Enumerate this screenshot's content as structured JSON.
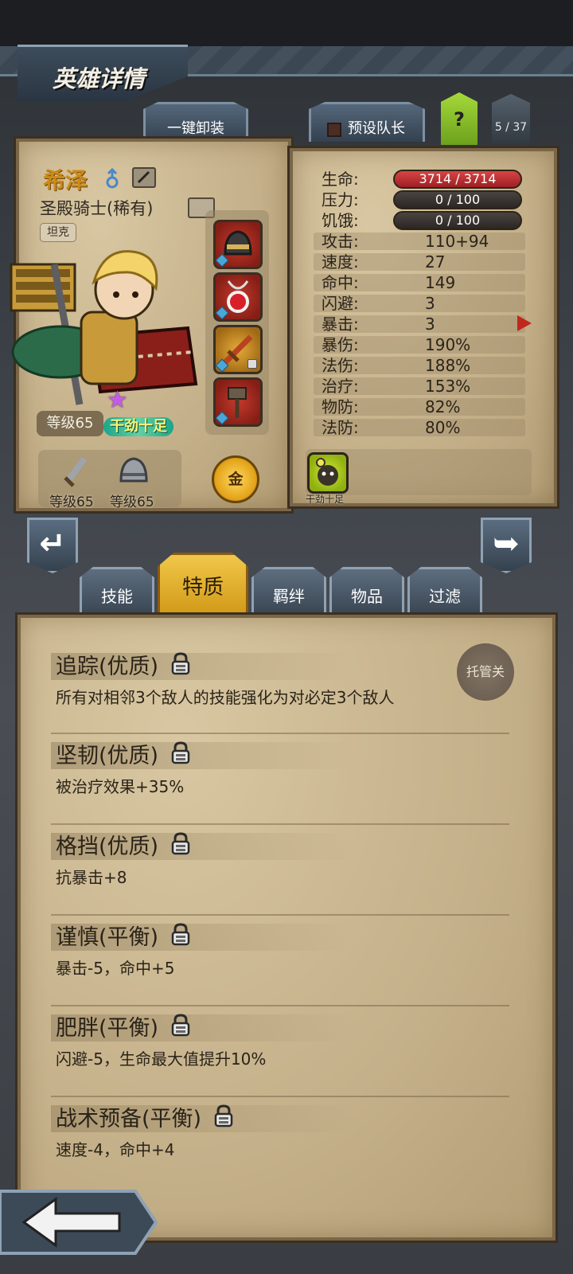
{
  "header": {
    "title": "英雄详情"
  },
  "toolbar": {
    "unequip_all": "一键卸装",
    "preset_leader": "预设队长",
    "help": "?",
    "page_counter": "5 / 37"
  },
  "hero": {
    "name": "希泽",
    "class": "圣殿骑士(稀有)",
    "role": "坦克",
    "level": "等级65",
    "trait_tag": "干劲十足",
    "weapon_level": "等级65",
    "armor_level": "等级65",
    "currency_label": "金"
  },
  "stats": {
    "hp": {
      "label": "生命:",
      "value": "3714 / 3714"
    },
    "stress": {
      "label": "压力:",
      "value": "0 / 100"
    },
    "hunger": {
      "label": "饥饿:",
      "value": "0 / 100"
    },
    "attack": {
      "label": "攻击:",
      "value": "110+94"
    },
    "speed": {
      "label": "速度:",
      "value": "27"
    },
    "accuracy": {
      "label": "命中:",
      "value": "149"
    },
    "dodge": {
      "label": "闪避:",
      "value": "3"
    },
    "crit": {
      "label": "暴击:",
      "value": "3"
    },
    "crit_dmg": {
      "label": "暴伤:",
      "value": "190%"
    },
    "magic_dmg": {
      "label": "法伤:",
      "value": "188%"
    },
    "healing": {
      "label": "治疗:",
      "value": "153%"
    },
    "phys_def": {
      "label": "物防:",
      "value": "82%"
    },
    "magic_def": {
      "label": "法防:",
      "value": "80%"
    }
  },
  "passive": {
    "label": "干劲十足"
  },
  "tabs": [
    {
      "label": "技能"
    },
    {
      "label": "特质"
    },
    {
      "label": "羁绊"
    },
    {
      "label": "物品"
    },
    {
      "label": "过滤"
    }
  ],
  "auto_toggle": "托管关",
  "traits": [
    {
      "title": "追踪(优质)",
      "desc": "所有对相邻3个敌人的技能强化为对必定3个敌人"
    },
    {
      "title": "坚韧(优质)",
      "desc": "被治疗效果+35%"
    },
    {
      "title": "格挡(优质)",
      "desc": "抗暴击+8"
    },
    {
      "title": "谨慎(平衡)",
      "desc": "暴击-5，命中+5"
    },
    {
      "title": "肥胖(平衡)",
      "desc": "闪避-5，生命最大值提升10%"
    },
    {
      "title": "战术预备(平衡)",
      "desc": "速度-4，命中+4"
    }
  ],
  "colors": {
    "accent_gold": "#e9b52f",
    "hp_red": "#c0282e",
    "parchment": "#c9b68f",
    "hero_name": "#cc8a1a",
    "trait_tag": "#f8f37a"
  },
  "icons": [
    "gender-male-icon",
    "edit-icon",
    "class-icon",
    "star-icon",
    "helmet-icon",
    "sword-icon",
    "lock-icon",
    "gold-coin-icon",
    "back-arrow-icon"
  ]
}
